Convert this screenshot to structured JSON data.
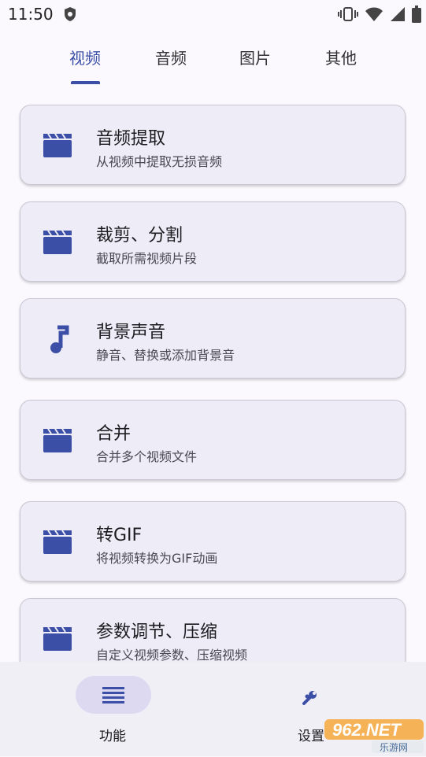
{
  "status_bar": {
    "time": "11:50",
    "icons": [
      "shield-icon",
      "vibrate-icon",
      "wifi-icon",
      "signal-icon",
      "battery-icon"
    ]
  },
  "tabs": [
    {
      "label": "视频",
      "active": true
    },
    {
      "label": "音频",
      "active": false
    },
    {
      "label": "图片",
      "active": false
    },
    {
      "label": "其他",
      "active": false
    }
  ],
  "cards": [
    {
      "title": "音频提取",
      "subtitle": "从视频中提取无损音频",
      "icon": "clapperboard-icon"
    },
    {
      "title": "裁剪、分割",
      "subtitle": "截取所需视频片段",
      "icon": "clapperboard-icon"
    },
    {
      "title": "背景声音",
      "subtitle": "静音、替换或添加背景音",
      "icon": "music-note-icon"
    },
    {
      "title": "合并",
      "subtitle": "合并多个视频文件",
      "icon": "clapperboard-icon"
    },
    {
      "title": "转GIF",
      "subtitle": "将视频转换为GIF动画",
      "icon": "clapperboard-icon"
    },
    {
      "title": "参数调节、压缩",
      "subtitle": "自定义视频参数、压缩视频",
      "icon": "clapperboard-icon"
    }
  ],
  "bottom_nav": {
    "items": [
      {
        "label": "功能",
        "icon": "menu-icon",
        "active": true
      },
      {
        "label": "设置",
        "icon": "wrench-icon",
        "active": false
      }
    ]
  },
  "watermark": {
    "brand": "962.NET",
    "tagline": "乐游网"
  },
  "colors": {
    "accent": "#3c4fa6",
    "card_bg": "#eeecf6",
    "nav_bg": "#f1eff6",
    "nav_pill": "#ddd9f0"
  }
}
